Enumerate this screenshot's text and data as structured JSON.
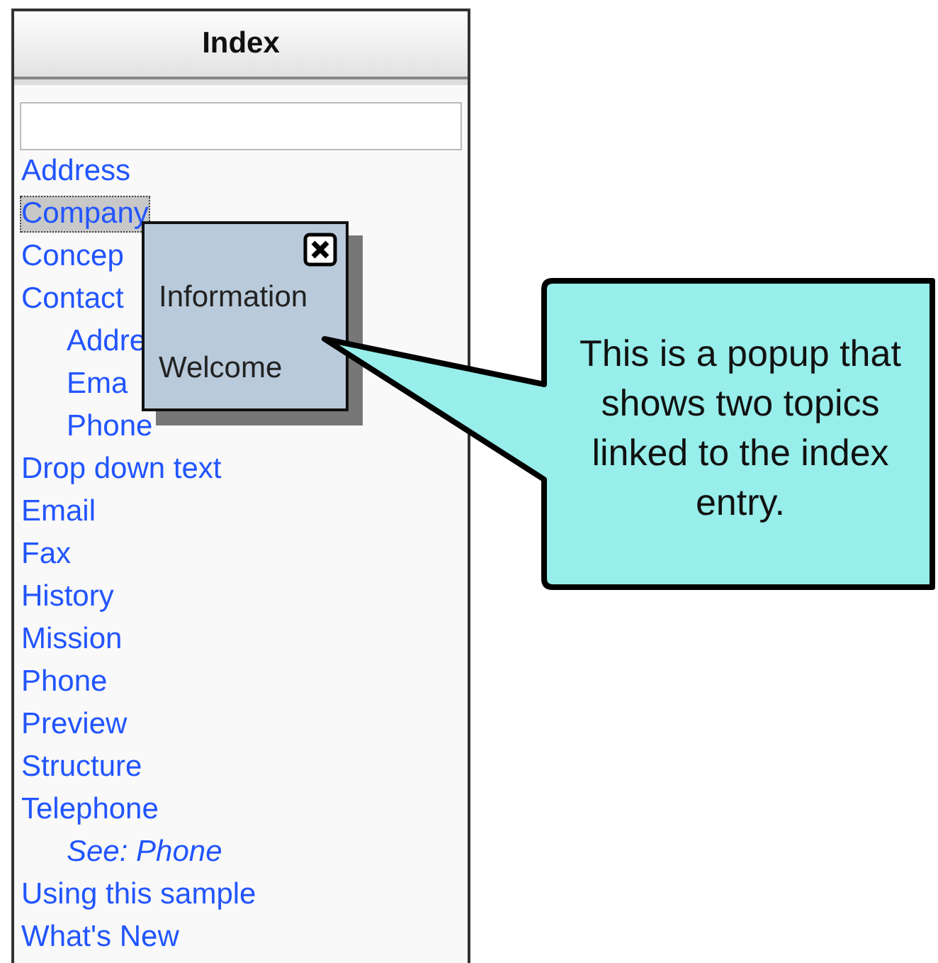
{
  "panel": {
    "title": "Index",
    "entries": [
      {
        "label": "Address",
        "kind": "entry",
        "selected": false
      },
      {
        "label": "Company",
        "kind": "entry",
        "selected": true
      },
      {
        "label": "Concep",
        "kind": "entry",
        "selected": false
      },
      {
        "label": "Contact",
        "kind": "entry",
        "selected": false,
        "children": [
          {
            "label": "Addre",
            "kind": "entry",
            "selected": false
          },
          {
            "label": "Ema",
            "kind": "entry",
            "selected": false
          },
          {
            "label": "Phone",
            "kind": "entry",
            "selected": false
          }
        ]
      },
      {
        "label": "Drop down text",
        "kind": "entry",
        "selected": false
      },
      {
        "label": "Email",
        "kind": "entry",
        "selected": false
      },
      {
        "label": "Fax",
        "kind": "entry",
        "selected": false
      },
      {
        "label": "History",
        "kind": "entry",
        "selected": false
      },
      {
        "label": "Mission",
        "kind": "entry",
        "selected": false
      },
      {
        "label": "Phone",
        "kind": "entry",
        "selected": false
      },
      {
        "label": "Preview",
        "kind": "entry",
        "selected": false
      },
      {
        "label": "Structure",
        "kind": "entry",
        "selected": false
      },
      {
        "label": "Telephone",
        "kind": "entry",
        "selected": false,
        "children": [
          {
            "label": "See: Phone",
            "kind": "see",
            "selected": false
          }
        ]
      },
      {
        "label": "Using this sample",
        "kind": "entry",
        "selected": false
      },
      {
        "label": "What's New",
        "kind": "entry",
        "selected": false
      }
    ]
  },
  "popup": {
    "topics": [
      "Information",
      "Welcome"
    ]
  },
  "callout": {
    "text": "This is a popup that shows two topics linked to the index entry."
  }
}
